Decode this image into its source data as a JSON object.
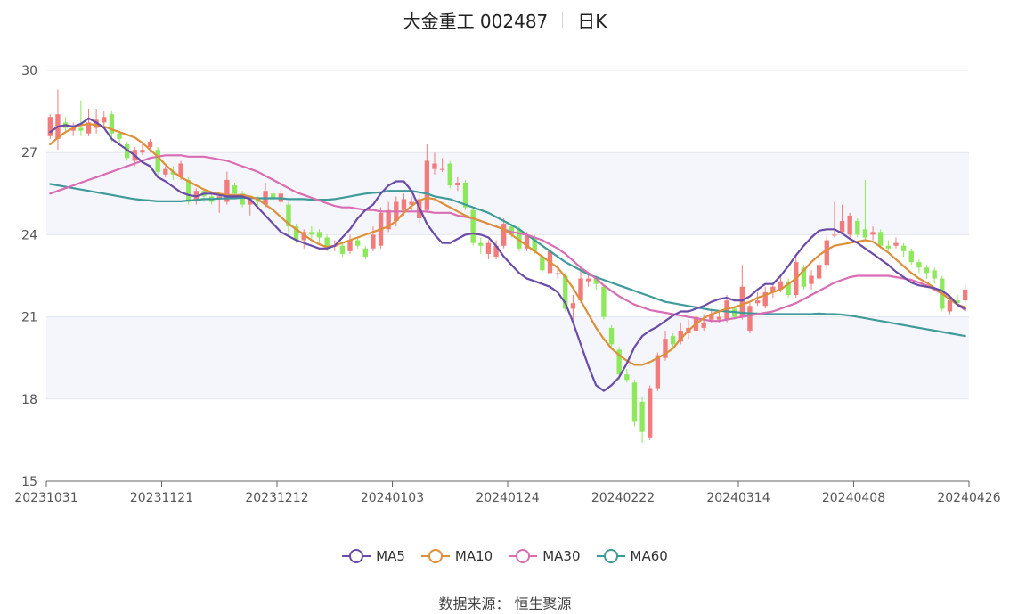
{
  "title": {
    "name": "大金重工 002487",
    "period": "日K"
  },
  "source": "数据来源： 恒生聚源",
  "colors": {
    "up": "#f27c7c",
    "down": "#8de85b",
    "ma5": "#6a4ba8",
    "ma10": "#de8f3a",
    "ma30": "#d96cb3",
    "ma60": "#3f9a9a",
    "band": "#f4f6fb",
    "grid": "#e3e7f0"
  },
  "chart_data": {
    "type": "candlestick",
    "ylim": [
      15,
      30
    ],
    "y_ticks": [
      "15",
      "18",
      "21",
      "24",
      "27",
      "30"
    ],
    "x_ticks": [
      "20231031",
      "20231121",
      "20231212",
      "20240103",
      "20240124",
      "20240222",
      "20240314",
      "20240408",
      "20240426"
    ],
    "legend": [
      "MA5",
      "MA10",
      "MA30",
      "MA60"
    ],
    "trading_days": 120,
    "candles": [
      {
        "o": 27.6,
        "c": 28.3,
        "h": 28.4,
        "l": 27.5
      },
      {
        "o": 27.5,
        "c": 28.4,
        "h": 29.3,
        "l": 27.1
      },
      {
        "o": 28.1,
        "c": 27.9,
        "h": 28.3,
        "l": 27.7
      },
      {
        "o": 27.8,
        "c": 27.9,
        "h": 28.1,
        "l": 27.6
      },
      {
        "o": 27.9,
        "c": 27.8,
        "h": 28.9,
        "l": 27.6
      },
      {
        "o": 27.7,
        "c": 28.1,
        "h": 28.6,
        "l": 27.6
      },
      {
        "o": 27.9,
        "c": 28.2,
        "h": 28.6,
        "l": 27.7
      },
      {
        "o": 28.1,
        "c": 28.3,
        "h": 28.5,
        "l": 27.9
      },
      {
        "o": 28.4,
        "c": 27.7,
        "h": 28.5,
        "l": 27.4
      },
      {
        "o": 27.7,
        "c": 27.5,
        "h": 27.8,
        "l": 27.3
      },
      {
        "o": 27.3,
        "c": 26.8,
        "h": 27.4,
        "l": 26.7
      },
      {
        "o": 26.7,
        "c": 27.1,
        "h": 27.2,
        "l": 26.5
      },
      {
        "o": 27.0,
        "c": 27.1,
        "h": 27.3,
        "l": 26.9
      },
      {
        "o": 27.2,
        "c": 27.4,
        "h": 27.5,
        "l": 27.0
      },
      {
        "o": 27.1,
        "c": 26.3,
        "h": 27.2,
        "l": 26.1
      },
      {
        "o": 26.2,
        "c": 26.4,
        "h": 26.5,
        "l": 26.1
      },
      {
        "o": 26.3,
        "c": 26.2,
        "h": 26.5,
        "l": 26.0
      },
      {
        "o": 26.1,
        "c": 26.6,
        "h": 26.7,
        "l": 26.0
      },
      {
        "o": 26.0,
        "c": 25.2,
        "h": 26.1,
        "l": 25.1
      },
      {
        "o": 25.3,
        "c": 25.6,
        "h": 25.7,
        "l": 25.1
      },
      {
        "o": 25.6,
        "c": 25.4,
        "h": 25.7,
        "l": 25.2
      },
      {
        "o": 25.4,
        "c": 25.2,
        "h": 25.5,
        "l": 25.1
      },
      {
        "o": 25.3,
        "c": 25.4,
        "h": 25.5,
        "l": 24.8
      },
      {
        "o": 25.2,
        "c": 26.0,
        "h": 26.3,
        "l": 25.1
      },
      {
        "o": 25.8,
        "c": 25.5,
        "h": 25.9,
        "l": 25.3
      },
      {
        "o": 25.5,
        "c": 25.1,
        "h": 25.6,
        "l": 25.0
      },
      {
        "o": 25.1,
        "c": 25.3,
        "h": 25.4,
        "l": 24.7
      },
      {
        "o": 25.3,
        "c": 25.2,
        "h": 25.4,
        "l": 25.0
      },
      {
        "o": 25.1,
        "c": 25.6,
        "h": 25.9,
        "l": 25.0
      },
      {
        "o": 25.5,
        "c": 25.3,
        "h": 25.6,
        "l": 25.2
      },
      {
        "o": 25.2,
        "c": 25.5,
        "h": 25.6,
        "l": 25.1
      },
      {
        "o": 25.1,
        "c": 24.3,
        "h": 25.2,
        "l": 24.0
      },
      {
        "o": 24.3,
        "c": 23.8,
        "h": 24.4,
        "l": 23.7
      },
      {
        "o": 23.8,
        "c": 24.1,
        "h": 24.2,
        "l": 23.5
      },
      {
        "o": 24.1,
        "c": 24.0,
        "h": 24.3,
        "l": 23.8
      },
      {
        "o": 24.1,
        "c": 23.9,
        "h": 24.2,
        "l": 23.7
      },
      {
        "o": 23.9,
        "c": 23.5,
        "h": 24.0,
        "l": 23.4
      },
      {
        "o": 23.6,
        "c": 23.6,
        "h": 23.8,
        "l": 23.4
      },
      {
        "o": 23.6,
        "c": 23.3,
        "h": 23.7,
        "l": 23.2
      },
      {
        "o": 23.4,
        "c": 23.8,
        "h": 24.0,
        "l": 23.3
      },
      {
        "o": 23.8,
        "c": 23.6,
        "h": 23.9,
        "l": 23.5
      },
      {
        "o": 23.5,
        "c": 23.2,
        "h": 23.6,
        "l": 23.1
      },
      {
        "o": 23.5,
        "c": 24.0,
        "h": 24.3,
        "l": 23.4
      },
      {
        "o": 23.6,
        "c": 24.8,
        "h": 25.0,
        "l": 23.5
      },
      {
        "o": 24.2,
        "c": 24.9,
        "h": 25.2,
        "l": 24.1
      },
      {
        "o": 24.5,
        "c": 25.2,
        "h": 25.4,
        "l": 24.3
      },
      {
        "o": 24.9,
        "c": 25.3,
        "h": 25.5,
        "l": 24.7
      },
      {
        "o": 25.1,
        "c": 25.2,
        "h": 25.4,
        "l": 24.9
      },
      {
        "o": 24.6,
        "c": 25.3,
        "h": 25.5,
        "l": 24.4
      },
      {
        "o": 24.9,
        "c": 26.7,
        "h": 27.3,
        "l": 24.8
      },
      {
        "o": 26.4,
        "c": 26.6,
        "h": 27.0,
        "l": 26.2
      },
      {
        "o": 26.4,
        "c": 26.4,
        "h": 26.8,
        "l": 26.3
      },
      {
        "o": 26.6,
        "c": 25.8,
        "h": 26.7,
        "l": 25.7
      },
      {
        "o": 25.8,
        "c": 25.9,
        "h": 26.1,
        "l": 25.6
      },
      {
        "o": 25.9,
        "c": 25.0,
        "h": 26.0,
        "l": 24.9
      },
      {
        "o": 24.9,
        "c": 23.7,
        "h": 25.0,
        "l": 23.6
      },
      {
        "o": 23.7,
        "c": 23.6,
        "h": 23.9,
        "l": 23.3
      },
      {
        "o": 23.3,
        "c": 23.7,
        "h": 23.8,
        "l": 23.1
      },
      {
        "o": 23.2,
        "c": 23.6,
        "h": 23.8,
        "l": 23.1
      },
      {
        "o": 23.6,
        "c": 24.4,
        "h": 24.6,
        "l": 23.5
      },
      {
        "o": 24.3,
        "c": 24.0,
        "h": 24.4,
        "l": 23.9
      },
      {
        "o": 24.2,
        "c": 23.5,
        "h": 24.3,
        "l": 23.4
      },
      {
        "o": 23.5,
        "c": 24.0,
        "h": 24.1,
        "l": 23.4
      },
      {
        "o": 23.9,
        "c": 23.4,
        "h": 24.0,
        "l": 23.3
      },
      {
        "o": 23.2,
        "c": 22.7,
        "h": 23.3,
        "l": 22.6
      },
      {
        "o": 22.6,
        "c": 23.4,
        "h": 23.5,
        "l": 22.5
      },
      {
        "o": 22.6,
        "c": 22.6,
        "h": 22.9,
        "l": 22.4
      },
      {
        "o": 22.5,
        "c": 21.3,
        "h": 22.6,
        "l": 21.2
      },
      {
        "o": 21.3,
        "c": 21.5,
        "h": 21.8,
        "l": 20.9
      },
      {
        "o": 21.6,
        "c": 22.4,
        "h": 22.8,
        "l": 21.5
      },
      {
        "o": 22.3,
        "c": 22.4,
        "h": 22.6,
        "l": 22.1
      },
      {
        "o": 22.4,
        "c": 22.2,
        "h": 22.5,
        "l": 22.0
      },
      {
        "o": 22.1,
        "c": 21.0,
        "h": 22.2,
        "l": 20.9
      },
      {
        "o": 20.6,
        "c": 20.0,
        "h": 20.7,
        "l": 19.9
      },
      {
        "o": 19.8,
        "c": 18.9,
        "h": 19.9,
        "l": 18.7
      },
      {
        "o": 18.9,
        "c": 18.7,
        "h": 19.1,
        "l": 18.6
      },
      {
        "o": 18.6,
        "c": 17.2,
        "h": 18.7,
        "l": 17.0
      },
      {
        "o": 17.9,
        "c": 16.8,
        "h": 18.1,
        "l": 16.4
      },
      {
        "o": 16.6,
        "c": 18.4,
        "h": 18.5,
        "l": 16.5
      },
      {
        "o": 18.4,
        "c": 19.6,
        "h": 19.7,
        "l": 18.3
      },
      {
        "o": 19.5,
        "c": 20.2,
        "h": 20.5,
        "l": 19.4
      },
      {
        "o": 20.3,
        "c": 20.0,
        "h": 20.4,
        "l": 19.9
      },
      {
        "o": 20.1,
        "c": 20.5,
        "h": 20.8,
        "l": 20.0
      },
      {
        "o": 20.4,
        "c": 20.6,
        "h": 20.9,
        "l": 20.2
      },
      {
        "o": 20.5,
        "c": 21.0,
        "h": 21.7,
        "l": 20.4
      },
      {
        "o": 20.6,
        "c": 20.8,
        "h": 21.1,
        "l": 20.5
      },
      {
        "o": 20.9,
        "c": 21.1,
        "h": 21.3,
        "l": 20.8
      },
      {
        "o": 20.9,
        "c": 21.0,
        "h": 21.2,
        "l": 20.8
      },
      {
        "o": 20.9,
        "c": 21.6,
        "h": 21.8,
        "l": 20.8
      },
      {
        "o": 21.3,
        "c": 21.0,
        "h": 21.4,
        "l": 20.9
      },
      {
        "o": 21.0,
        "c": 22.1,
        "h": 22.9,
        "l": 20.9
      },
      {
        "o": 20.5,
        "c": 21.4,
        "h": 21.5,
        "l": 20.4
      },
      {
        "o": 21.5,
        "c": 21.6,
        "h": 21.9,
        "l": 21.4
      },
      {
        "o": 21.4,
        "c": 21.9,
        "h": 22.1,
        "l": 21.3
      },
      {
        "o": 21.9,
        "c": 22.1,
        "h": 22.2,
        "l": 21.7
      },
      {
        "o": 22.0,
        "c": 22.3,
        "h": 22.5,
        "l": 21.9
      },
      {
        "o": 22.3,
        "c": 21.8,
        "h": 22.4,
        "l": 21.7
      },
      {
        "o": 21.8,
        "c": 23.0,
        "h": 23.2,
        "l": 21.7
      },
      {
        "o": 22.8,
        "c": 22.1,
        "h": 22.9,
        "l": 22.0
      },
      {
        "o": 22.2,
        "c": 22.5,
        "h": 22.7,
        "l": 22.0
      },
      {
        "o": 22.4,
        "c": 22.9,
        "h": 23.0,
        "l": 22.3
      },
      {
        "o": 22.9,
        "c": 23.8,
        "h": 24.0,
        "l": 22.7
      },
      {
        "o": 24.0,
        "c": 24.0,
        "h": 25.2,
        "l": 23.9
      },
      {
        "o": 24.1,
        "c": 24.5,
        "h": 25.1,
        "l": 24.0
      },
      {
        "o": 24.0,
        "c": 24.7,
        "h": 24.8,
        "l": 23.8
      },
      {
        "o": 24.5,
        "c": 24.0,
        "h": 24.6,
        "l": 23.9
      },
      {
        "o": 24.2,
        "c": 23.9,
        "h": 26.0,
        "l": 23.8
      },
      {
        "o": 24.0,
        "c": 24.1,
        "h": 24.3,
        "l": 23.8
      },
      {
        "o": 24.1,
        "c": 23.6,
        "h": 24.2,
        "l": 23.5
      },
      {
        "o": 23.6,
        "c": 23.5,
        "h": 23.8,
        "l": 23.4
      },
      {
        "o": 23.6,
        "c": 23.7,
        "h": 23.9,
        "l": 23.5
      },
      {
        "o": 23.6,
        "c": 23.4,
        "h": 23.7,
        "l": 23.2
      },
      {
        "o": 23.4,
        "c": 23.0,
        "h": 23.5,
        "l": 22.9
      },
      {
        "o": 23.0,
        "c": 22.8,
        "h": 23.1,
        "l": 22.6
      },
      {
        "o": 22.8,
        "c": 22.6,
        "h": 22.9,
        "l": 22.4
      },
      {
        "o": 22.7,
        "c": 22.4,
        "h": 22.8,
        "l": 22.2
      },
      {
        "o": 22.4,
        "c": 21.3,
        "h": 22.5,
        "l": 21.2
      },
      {
        "o": 21.2,
        "c": 21.6,
        "h": 21.8,
        "l": 21.1
      },
      {
        "o": 21.6,
        "c": 21.5,
        "h": 21.8,
        "l": 21.4
      },
      {
        "o": 21.6,
        "c": 22.0,
        "h": 22.2,
        "l": 21.5
      }
    ],
    "ma5": [
      27.75,
      27.95,
      28.0,
      27.95,
      28.05,
      28.25,
      28.1,
      27.9,
      27.5,
      27.3,
      27.1,
      26.9,
      26.65,
      26.5,
      26.1,
      25.95,
      25.75,
      25.55,
      25.45,
      25.4,
      25.5,
      25.5,
      25.45,
      25.4,
      25.4,
      25.4,
      25.3,
      25.0,
      24.7,
      24.4,
      24.1,
      23.95,
      23.8,
      23.7,
      23.6,
      23.5,
      23.5,
      23.6,
      23.9,
      24.2,
      24.6,
      24.9,
      25.1,
      25.5,
      25.8,
      25.95,
      25.95,
      25.6,
      25.0,
      24.4,
      24.0,
      23.7,
      23.7,
      23.85,
      24.0,
      24.05,
      24.0,
      23.9,
      23.6,
      23.2,
      22.9,
      22.6,
      22.4,
      22.3,
      22.2,
      22.1,
      21.9,
      21.5,
      20.8,
      20.0,
      19.2,
      18.5,
      18.3,
      18.5,
      18.8,
      19.3,
      19.9,
      20.3,
      20.5,
      20.65,
      20.85,
      21.05,
      21.2,
      21.2,
      21.3,
      21.4,
      21.55,
      21.65,
      21.7,
      21.6,
      21.6,
      21.75,
      22.0,
      22.2,
      22.2,
      22.5,
      22.85,
      23.25,
      23.6,
      23.9,
      24.15,
      24.2,
      24.2,
      24.05,
      23.85,
      23.7,
      23.5,
      23.3,
      23.1,
      22.9,
      22.65,
      22.45,
      22.25,
      22.15,
      22.1,
      22.05,
      21.95,
      21.75,
      21.45,
      21.3
    ],
    "ma10": [
      27.3,
      27.55,
      27.75,
      27.9,
      28.0,
      28.05,
      28.0,
      27.95,
      27.85,
      27.75,
      27.65,
      27.55,
      27.35,
      27.1,
      26.85,
      26.55,
      26.3,
      26.1,
      25.95,
      25.8,
      25.65,
      25.55,
      25.5,
      25.45,
      25.45,
      25.45,
      25.4,
      25.3,
      25.1,
      24.9,
      24.65,
      24.4,
      24.2,
      24.0,
      23.8,
      23.65,
      23.55,
      23.6,
      23.7,
      23.8,
      23.9,
      24.0,
      24.1,
      24.2,
      24.3,
      24.5,
      24.8,
      25.05,
      25.25,
      25.35,
      25.3,
      25.15,
      25.0,
      24.85,
      24.7,
      24.6,
      24.5,
      24.4,
      24.3,
      24.2,
      24.0,
      23.8,
      23.6,
      23.4,
      23.2,
      23.0,
      22.8,
      22.45,
      22.05,
      21.6,
      21.1,
      20.6,
      20.2,
      19.85,
      19.6,
      19.4,
      19.25,
      19.25,
      19.35,
      19.5,
      19.65,
      19.85,
      20.2,
      20.5,
      20.75,
      20.95,
      21.1,
      21.2,
      21.3,
      21.35,
      21.45,
      21.55,
      21.7,
      21.8,
      21.9,
      22.0,
      22.2,
      22.4,
      22.7,
      23.0,
      23.25,
      23.45,
      23.6,
      23.65,
      23.7,
      23.75,
      23.8,
      23.75,
      23.55,
      23.35,
      23.1,
      22.85,
      22.6,
      22.4,
      22.25,
      22.05,
      21.85,
      21.65,
      21.45,
      21.35
    ],
    "ma30": [
      25.5,
      25.6,
      25.7,
      25.8,
      25.9,
      26.0,
      26.1,
      26.2,
      26.3,
      26.4,
      26.5,
      26.6,
      26.7,
      26.8,
      26.85,
      26.9,
      26.9,
      26.9,
      26.85,
      26.85,
      26.85,
      26.8,
      26.75,
      26.7,
      26.6,
      26.5,
      26.4,
      26.3,
      26.15,
      26.0,
      25.85,
      25.7,
      25.55,
      25.45,
      25.35,
      25.25,
      25.15,
      25.05,
      25.0,
      25.0,
      24.95,
      24.9,
      24.9,
      24.85,
      24.85,
      24.85,
      24.85,
      24.85,
      24.85,
      24.85,
      24.8,
      24.8,
      24.8,
      24.7,
      24.65,
      24.6,
      24.5,
      24.4,
      24.3,
      24.2,
      24.1,
      24.05,
      24.0,
      23.9,
      23.8,
      23.65,
      23.5,
      23.3,
      23.05,
      22.8,
      22.6,
      22.4,
      22.15,
      21.95,
      21.75,
      21.6,
      21.45,
      21.35,
      21.25,
      21.2,
      21.15,
      21.1,
      21.05,
      21.0,
      20.95,
      20.9,
      20.85,
      20.85,
      20.9,
      20.95,
      21.0,
      21.05,
      21.1,
      21.15,
      21.2,
      21.3,
      21.4,
      21.5,
      21.65,
      21.8,
      21.95,
      22.1,
      22.25,
      22.35,
      22.45,
      22.5,
      22.5,
      22.5,
      22.5,
      22.5,
      22.45,
      22.4,
      22.35,
      22.25,
      22.15,
      22.0,
      21.85,
      21.65,
      21.45,
      21.25
    ],
    "ma60": [
      25.85,
      25.8,
      25.75,
      25.7,
      25.65,
      25.6,
      25.55,
      25.5,
      25.45,
      25.4,
      25.35,
      25.3,
      25.27,
      25.25,
      25.22,
      25.22,
      25.22,
      25.22,
      25.25,
      25.27,
      25.3,
      25.3,
      25.32,
      25.33,
      25.33,
      25.35,
      25.35,
      25.33,
      25.33,
      25.33,
      25.33,
      25.3,
      25.3,
      25.3,
      25.28,
      25.28,
      25.28,
      25.3,
      25.35,
      25.4,
      25.45,
      25.5,
      25.53,
      25.55,
      25.6,
      25.6,
      25.6,
      25.6,
      25.55,
      25.5,
      25.4,
      25.35,
      25.3,
      25.2,
      25.1,
      25.0,
      24.9,
      24.8,
      24.65,
      24.5,
      24.35,
      24.2,
      24.0,
      23.8,
      23.6,
      23.4,
      23.2,
      23.0,
      22.85,
      22.7,
      22.55,
      22.45,
      22.35,
      22.25,
      22.15,
      22.05,
      21.95,
      21.85,
      21.75,
      21.65,
      21.55,
      21.5,
      21.45,
      21.4,
      21.35,
      21.3,
      21.25,
      21.22,
      21.2,
      21.18,
      21.15,
      21.13,
      21.12,
      21.1,
      21.1,
      21.1,
      21.1,
      21.1,
      21.1,
      21.1,
      21.12,
      21.1,
      21.1,
      21.08,
      21.05,
      21.0,
      20.95,
      20.9,
      20.85,
      20.8,
      20.75,
      20.7,
      20.65,
      20.6,
      20.55,
      20.5,
      20.45,
      20.4,
      20.35,
      20.3
    ]
  }
}
